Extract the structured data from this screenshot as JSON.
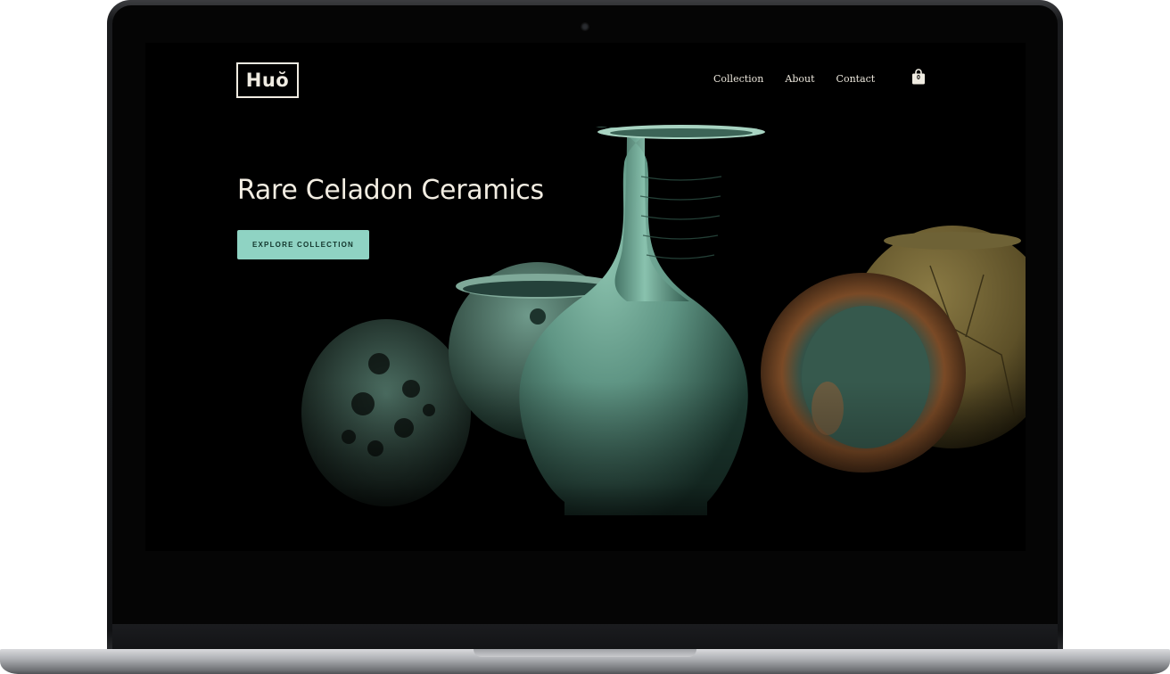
{
  "site": {
    "logo_text": "Huŏ"
  },
  "nav": {
    "items": [
      {
        "label": "Collection"
      },
      {
        "label": "About"
      },
      {
        "label": "Contact"
      }
    ],
    "cart_count": "0"
  },
  "hero": {
    "title": "Rare Celadon Ceramics",
    "cta_label": "EXPLORE COLLECTION"
  },
  "colors": {
    "background": "#000000",
    "accent": "#8fd3c3",
    "text": "#f2ede2",
    "celadon": "#5f9584"
  },
  "icons": {
    "cart": "shopping-bag-icon"
  }
}
